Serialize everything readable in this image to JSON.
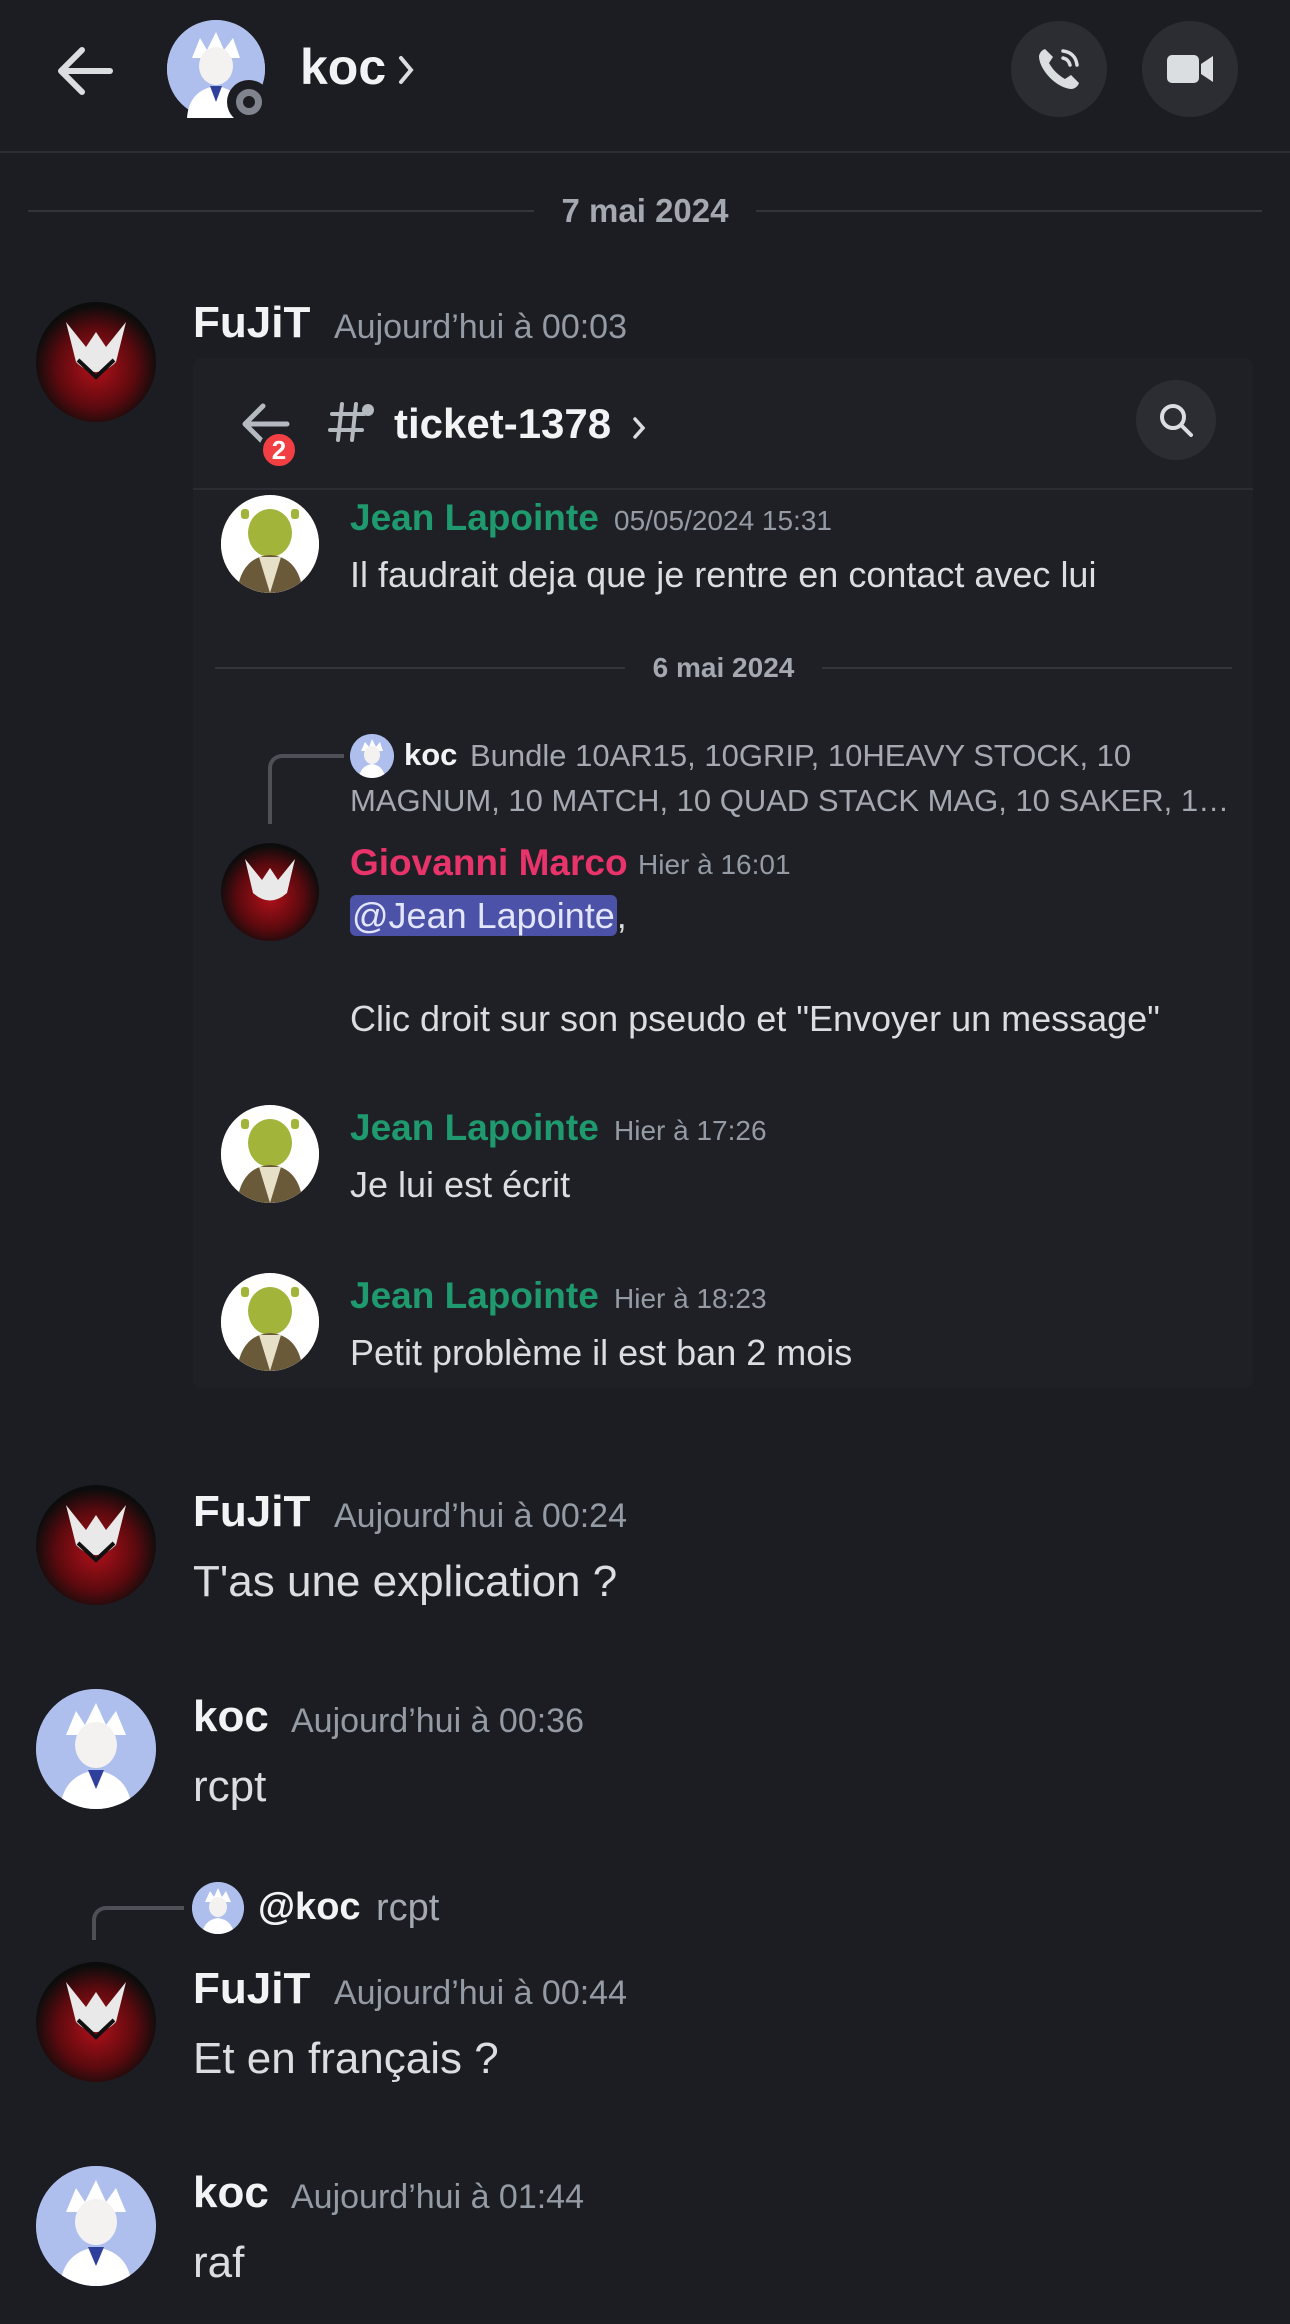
{
  "header": {
    "title": "koc",
    "back_icon": "arrow-left-icon",
    "call_icon": "phone-icon",
    "video_icon": "video-camera-icon"
  },
  "date_divider": "7 mai 2024",
  "messages": [
    {
      "author": "FuJiT",
      "time": "Aujourd’hui à 00:03"
    },
    {
      "author": "FuJiT",
      "time": "Aujourd’hui à 00:24",
      "text": "T'as une explication ?"
    },
    {
      "author": "koc",
      "time": "Aujourd’hui à 00:36",
      "text": "rcpt"
    },
    {
      "reply_author": "@koc",
      "reply_text": "rcpt",
      "author": "FuJiT",
      "time": "Aujourd’hui à 00:44",
      "text": "Et en français ?"
    },
    {
      "author": "koc",
      "time": "Aujourd’hui à 01:44",
      "text": "raf"
    }
  ],
  "embed": {
    "badge": "2",
    "channel": "ticket-1378",
    "date_divider": "6 mai 2024",
    "messages": [
      {
        "author": "Jean Lapointe",
        "time": "05/05/2024 15:31",
        "text": "Il faudrait deja que je rentre en contact avec lui"
      },
      {
        "reply_author": "koc",
        "reply_line1": "Bundle 10AR15, 10GRIP, 10HEAVY STOCK, 10",
        "reply_line2": "MAGNUM, 10 MATCH, 10 QUAD STACK MAG, 10 SAKER, 1…",
        "author": "Giovanni Marco",
        "time": "Hier à 16:01",
        "mention": "@Jean Lapointe",
        "mention_suffix": ",",
        "text": "Clic droit sur son pseudo et \"Envoyer un message\""
      },
      {
        "author": "Jean Lapointe",
        "time": "Hier à 17:26",
        "text": "Je lui est écrit"
      },
      {
        "author": "Jean Lapointe",
        "time": "Hier à 18:23",
        "text": "Petit problème il est ban 2 mois"
      }
    ]
  },
  "colors": {
    "background": "#1c1d22",
    "jean": "#1f9a6f",
    "giovanni": "#e8336b",
    "mention_bg": "#4b52a7"
  }
}
